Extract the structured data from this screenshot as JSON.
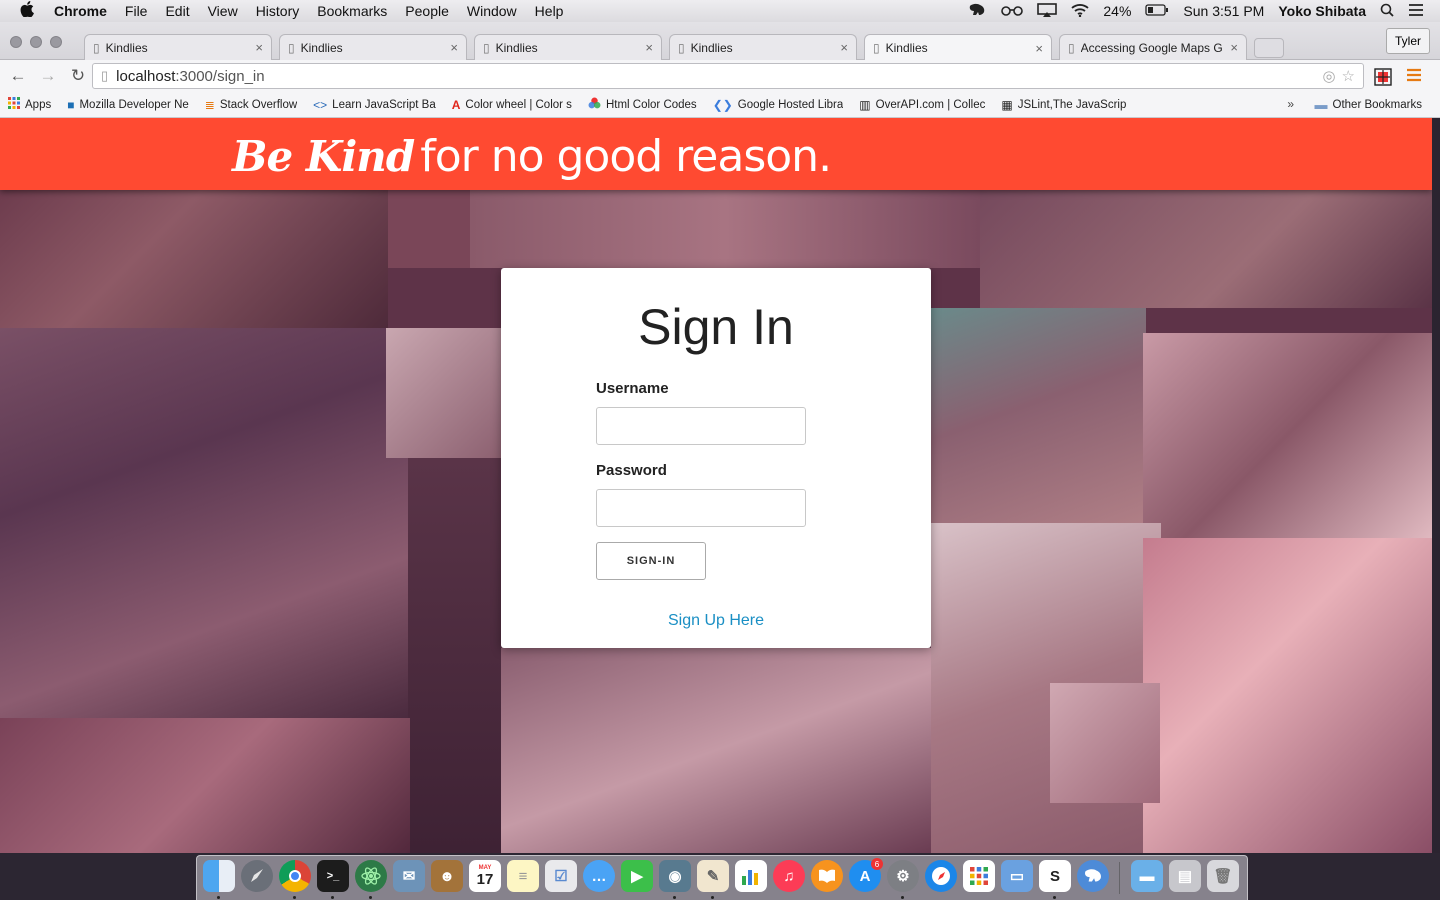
{
  "menubar": {
    "apple": "",
    "app": "Chrome",
    "items": [
      "File",
      "Edit",
      "View",
      "History",
      "Bookmarks",
      "People",
      "Window",
      "Help"
    ],
    "battery": "24%",
    "clock": "Sun 3:51 PM",
    "user": "Yoko Shibata"
  },
  "tabs": [
    {
      "title": "Kindlies",
      "active": false
    },
    {
      "title": "Kindlies",
      "active": false
    },
    {
      "title": "Kindlies",
      "active": false
    },
    {
      "title": "Kindlies",
      "active": false
    },
    {
      "title": "Kindlies",
      "active": true
    },
    {
      "title": "Accessing Google Maps G",
      "active": false
    }
  ],
  "profile": "Tyler",
  "address": {
    "host": "localhost",
    "path": ":3000/sign_in"
  },
  "bookmarks": [
    {
      "label": "Apps",
      "icon": "apps-grid-icon"
    },
    {
      "label": "Mozilla Developer Ne",
      "icon": "mdn-icon"
    },
    {
      "label": "Stack Overflow",
      "icon": "stackoverflow-icon"
    },
    {
      "label": "Learn JavaScript Ba",
      "icon": "code-icon"
    },
    {
      "label": "Color wheel | Color s",
      "icon": "adobe-icon"
    },
    {
      "label": "Html Color Codes",
      "icon": "color-wheel-icon"
    },
    {
      "label": "Google Hosted Libra",
      "icon": "google-dev-icon"
    },
    {
      "label": "OverAPI.com | Collec",
      "icon": "overapi-icon"
    },
    {
      "label": "JSLint,The JavaScrip",
      "icon": "jslint-icon"
    }
  ],
  "bookmarks_overflow": "»",
  "other_bookmarks": "Other Bookmarks",
  "header": {
    "brand": "Be Kind",
    "tagline": "for no good reason."
  },
  "signin": {
    "title": "Sign In",
    "username_label": "Username",
    "username_value": "",
    "password_label": "Password",
    "password_value": "",
    "button": "SIGN-IN",
    "signup_link": "Sign Up Here"
  },
  "dock": {
    "calendar_month": "MAY",
    "calendar_day": "17",
    "appstore_badge": "6"
  },
  "colors": {
    "header_bg": "#ff4a31",
    "link": "#1a8fc4",
    "page_tint": "#5e3348"
  }
}
